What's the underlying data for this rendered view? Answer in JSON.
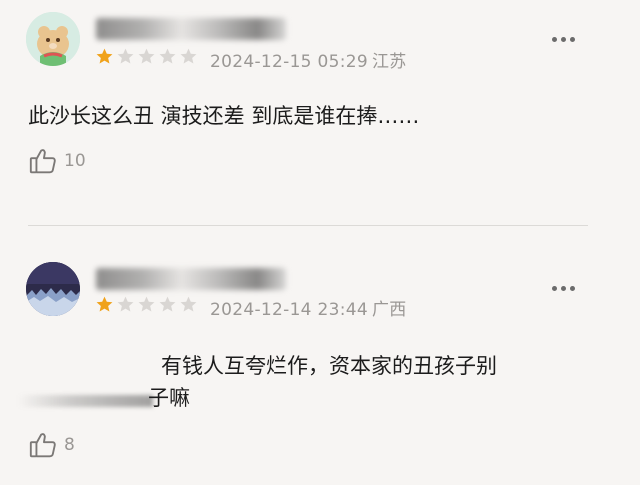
{
  "comments": [
    {
      "date": "2024-12-15 05:29",
      "location": "江苏",
      "rating": 1,
      "max_rating": 5,
      "text": "此沙长这么丑 演技还差 到底是谁在捧……",
      "likes": "10"
    },
    {
      "date": "2024-12-14 23:44",
      "location": "广西",
      "rating": 1,
      "max_rating": 5,
      "text_line1": "有钱人互夸烂作，资本家的丑孩子别",
      "text_line2": "子嘛",
      "likes": "8"
    }
  ],
  "colors": {
    "star_filled": "#f0a21a",
    "star_empty": "#d9d6d3",
    "meta_text": "#9a9794"
  },
  "icons": [
    "more-options-icon",
    "thumbs-up-icon",
    "star-icon"
  ]
}
